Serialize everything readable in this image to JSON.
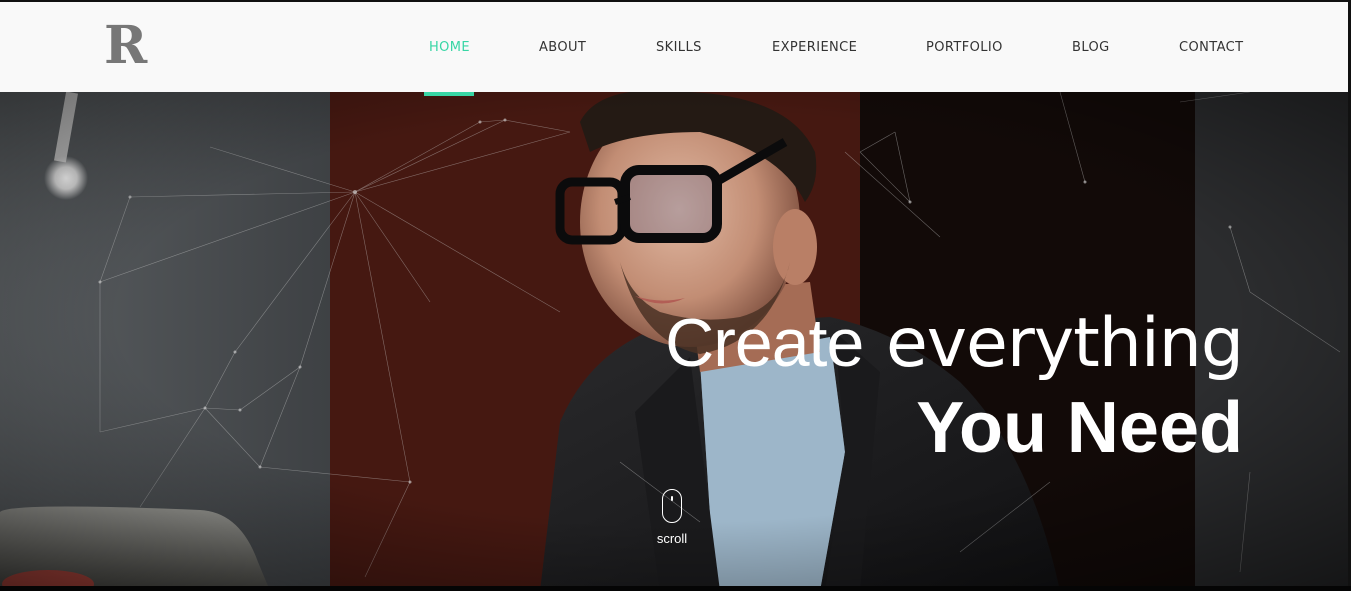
{
  "brand": {
    "logo_letter": "R"
  },
  "nav": {
    "items": [
      {
        "label": "HOME",
        "active": true
      },
      {
        "label": "ABOUT",
        "active": false
      },
      {
        "label": "SKILLS",
        "active": false
      },
      {
        "label": "EXPERIENCE",
        "active": false
      },
      {
        "label": "PORTFOLIO",
        "active": false
      },
      {
        "label": "BLOG",
        "active": false
      },
      {
        "label": "CONTACT",
        "active": false
      }
    ]
  },
  "hero": {
    "headline_light": "Create",
    "headline_bold": "everything",
    "headline_line2": "You Need",
    "scroll_label": "scroll",
    "background_image": "man-with-glasses-working-at-laptop-with-network-overlay"
  },
  "colors": {
    "accent": "#38d6a5",
    "header_bg": "#f9f9f9",
    "nav_text": "#333333",
    "logo": "#777777",
    "hero_text": "#ffffff"
  }
}
